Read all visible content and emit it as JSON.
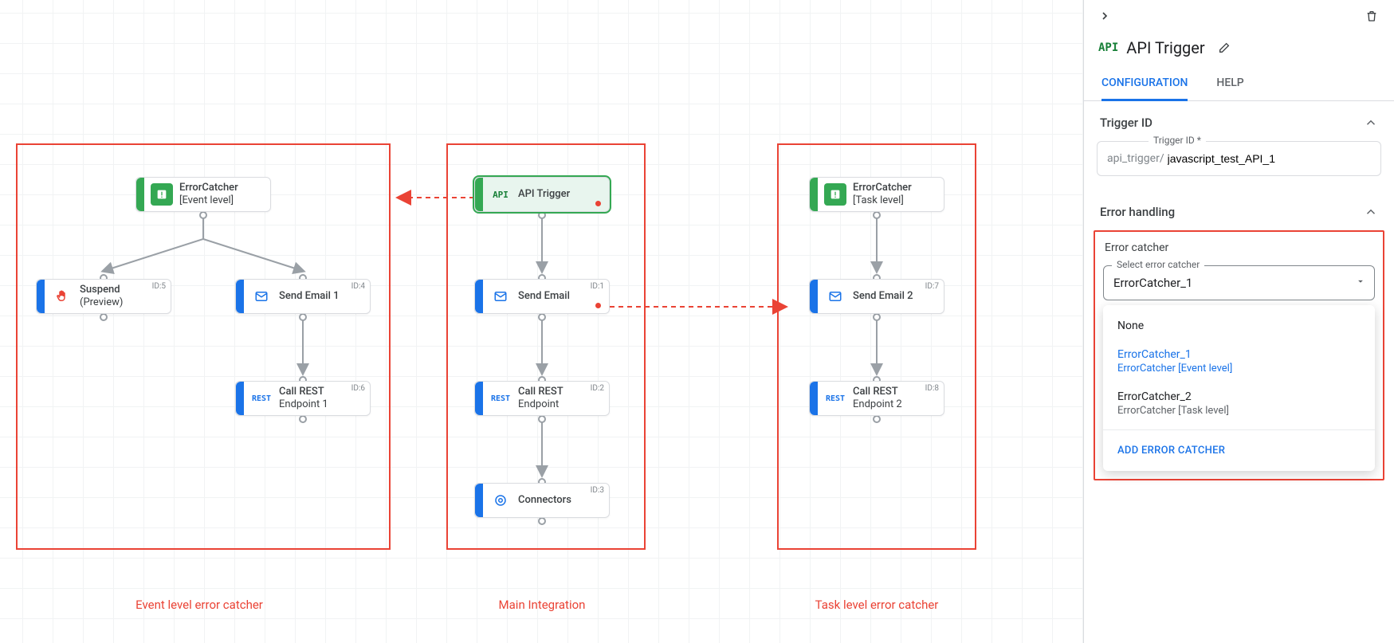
{
  "canvas": {
    "boxes": {
      "event": {
        "caption": "Event level error catcher"
      },
      "main": {
        "caption": "Main Integration"
      },
      "task": {
        "caption": "Task level error catcher"
      }
    },
    "nodes": {
      "ec_event": {
        "title": "ErrorCatcher",
        "sub": "[Event level]"
      },
      "suspend": {
        "title": "Suspend",
        "sub": "(Preview)",
        "id": "ID:5"
      },
      "email1": {
        "title": "Send Email 1",
        "id": "ID:4"
      },
      "rest1": {
        "title": "Call REST",
        "sub": "Endpoint 1",
        "id": "ID:6"
      },
      "api": {
        "title": "API Trigger"
      },
      "email": {
        "title": "Send Email",
        "id": "ID:1"
      },
      "rest": {
        "title": "Call REST",
        "sub": "Endpoint",
        "id": "ID:2"
      },
      "connectors": {
        "title": "Connectors",
        "id": "ID:3"
      },
      "ec_task": {
        "title": "ErrorCatcher",
        "sub": "[Task level]"
      },
      "email2": {
        "title": "Send Email 2",
        "id": "ID:7"
      },
      "rest2": {
        "title": "Call REST",
        "sub": "Endpoint 2",
        "id": "ID:8"
      }
    },
    "icons": {
      "api_text": "API",
      "rest_text": "REST"
    }
  },
  "panel": {
    "api_badge": "API",
    "title": "API Trigger",
    "tabs": {
      "configuration": "CONFIGURATION",
      "help": "HELP"
    },
    "trigger_section": "Trigger ID",
    "trigger_field_label": "Trigger ID *",
    "trigger_prefix": "api_trigger/",
    "trigger_value": "javascript_test_API_1",
    "error_section": "Error handling",
    "error_catcher_label": "Error catcher",
    "select_label": "Select error catcher",
    "select_value": "ErrorCatcher_1",
    "options": {
      "none": "None",
      "o1_main": "ErrorCatcher_1",
      "o1_sub": "ErrorCatcher [Event level]",
      "o2_main": "ErrorCatcher_2",
      "o2_sub": "ErrorCatcher [Task level]",
      "add": "ADD ERROR CATCHER"
    }
  }
}
